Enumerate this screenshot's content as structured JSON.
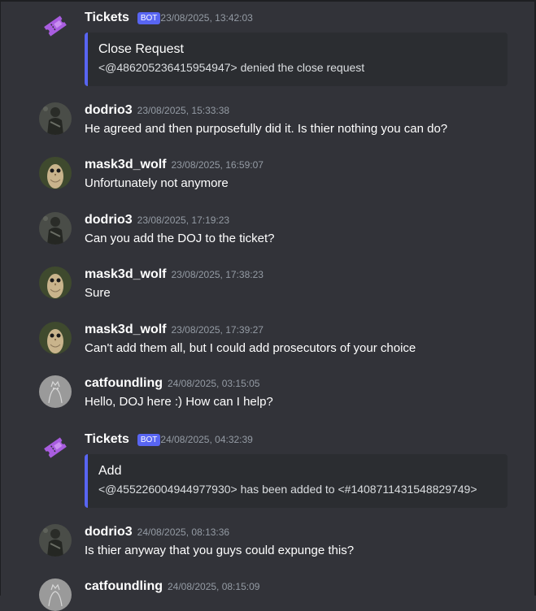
{
  "messages": [
    {
      "username": "Tickets",
      "badge": "BOT",
      "timestamp": "23/08/2025, 13:42:03",
      "avatar_icon": "ticket-icon",
      "embed": {
        "title": "Close Request",
        "description": "<@486205236415954947> denied the close request"
      }
    },
    {
      "username": "dodrio3",
      "timestamp": "23/08/2025, 15:33:38",
      "text": "He agreed and then purposefully did it. Is thier nothing you can do?"
    },
    {
      "username": "mask3d_wolf",
      "timestamp": "23/08/2025, 16:59:07",
      "text": "Unfortunately not anymore"
    },
    {
      "username": "dodrio3",
      "timestamp": "23/08/2025, 17:19:23",
      "text": "Can you add the DOJ to the ticket?"
    },
    {
      "username": "mask3d_wolf",
      "timestamp": "23/08/2025, 17:38:23",
      "text": "Sure"
    },
    {
      "username": "mask3d_wolf",
      "timestamp": "23/08/2025, 17:39:27",
      "text": "Can't add them all, but I could add prosecutors of your choice"
    },
    {
      "username": "catfoundling",
      "timestamp": "24/08/2025, 03:15:05",
      "text": "Hello, DOJ here :) How can I help?"
    },
    {
      "username": "Tickets",
      "badge": "BOT",
      "timestamp": "24/08/2025, 04:32:39",
      "avatar_icon": "ticket-icon",
      "embed": {
        "title": "Add",
        "description": "<@455226004944977930> has been added to <#1408711431548829749>"
      }
    },
    {
      "username": "dodrio3",
      "timestamp": "24/08/2025, 08:13:36",
      "text": "Is thier anyway that you guys could expunge this?"
    },
    {
      "username": "catfoundling",
      "timestamp": "24/08/2025, 08:15:09",
      "text": ""
    }
  ],
  "colors": {
    "background": "#323339",
    "embed_background": "#2b2d31",
    "embed_accent": "#5865f2",
    "bot_badge": "#5865f2",
    "ticket_icon": "#a95de0",
    "timestamp": "#949ba4"
  }
}
